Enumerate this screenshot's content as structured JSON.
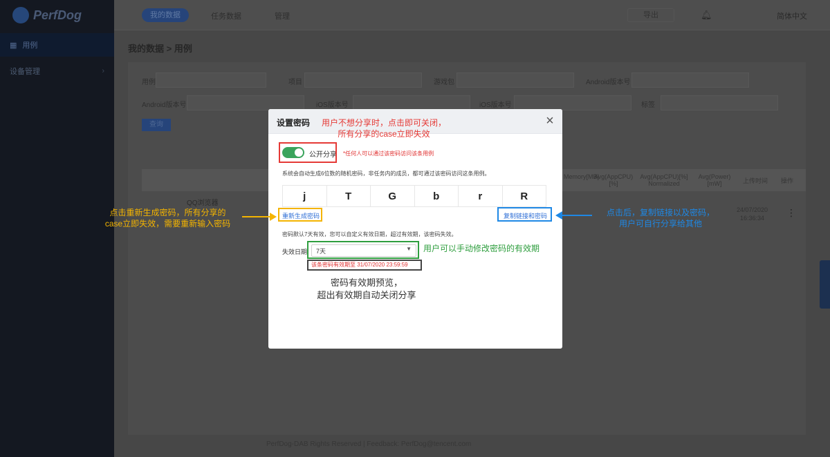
{
  "app": {
    "brand": "PerfDog"
  },
  "sidebar": {
    "items": [
      {
        "label": "用例"
      },
      {
        "label": "设备管理"
      }
    ]
  },
  "topbar": {
    "nav": [
      "我的数据",
      "任务数据",
      "管理"
    ],
    "button": "导出",
    "user": "",
    "language": "简体中文"
  },
  "breadcrumb": "我的数据 > 用例",
  "filters": {
    "row1": [
      "用例",
      "项目",
      "游戏包",
      "Android版本号"
    ],
    "row2": [
      "Android版本号",
      "iOS版本号",
      "iOS版本号",
      "标签"
    ],
    "search_button": "查询"
  },
  "table": {
    "headers": [
      "Memory[MB]",
      "Avg(AppCPU)[%]",
      "Avg(AppCPU)[%] Normalized",
      "Avg(Power)[mW]",
      "上传时间",
      "操作"
    ],
    "row": {
      "name": "QQ浏览器",
      "date": "24/07/2020",
      "time": "16:36:34"
    }
  },
  "footer": "PerfDog-DAB Rights Reserved | Feedback: PerfDog@tencent.com",
  "modal": {
    "title": "设置密码",
    "toggle_label": "公开分享",
    "toggle_on": true,
    "toggle_hint": "*任何人可以通过该密码访问该条用例",
    "desc": "系统会自动生成6位数的随机密码，非任务内的成员，都可通过该密码访问这条用例。",
    "password_chars": [
      "j",
      "T",
      "G",
      "b",
      "r",
      "R"
    ],
    "regenerate_link": "重新生成密码",
    "copy_link": "复制链接和密码",
    "validity_desc": "密码默认7天有效，您可以自定义有效日期，超过有效期，该密码失效。",
    "expiry_label": "失效日期",
    "expiry_value": "7天",
    "expiry_note": "该条密码有效期至 31/07/2020 23:59:59"
  },
  "annotations": {
    "toggle": [
      "用户不想分享时，点击即可关闭，",
      "所有分享的case立即失效"
    ],
    "regenerate": [
      "点击重新生成密码，所有分享的",
      "case立即失效，需要重新输入密码"
    ],
    "copy": [
      "点击后，复制链接以及密码，",
      "用户可自行分享给其他"
    ],
    "expiry": "用户可以手动修改密码的有效期",
    "preview": [
      "密码有效期预览，",
      "超出有效期自动关闭分享"
    ]
  },
  "colors": {
    "annotation_red": "#e53935",
    "annotation_yellow": "#f4b400",
    "annotation_blue": "#1e88e5",
    "annotation_green": "#2e9e3e",
    "toggle_green": "#3aa45c"
  }
}
